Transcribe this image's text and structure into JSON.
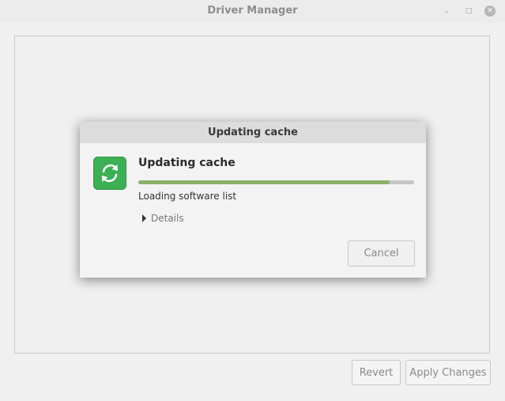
{
  "window": {
    "title": "Driver Manager",
    "controls": {
      "minimize": "minimize-icon",
      "maximize": "maximize-icon",
      "close": "close-icon"
    }
  },
  "footer": {
    "revert_label": "Revert",
    "apply_label": "Apply Changes"
  },
  "dialog": {
    "title": "Updating cache",
    "heading": "Updating cache",
    "icon": "refresh-icon",
    "progress": 0.91,
    "status": "Loading software list",
    "details_label": "Details",
    "cancel_label": "Cancel"
  },
  "colors": {
    "accent_green": "#3db055",
    "progress_fill": "#8bb36b"
  }
}
